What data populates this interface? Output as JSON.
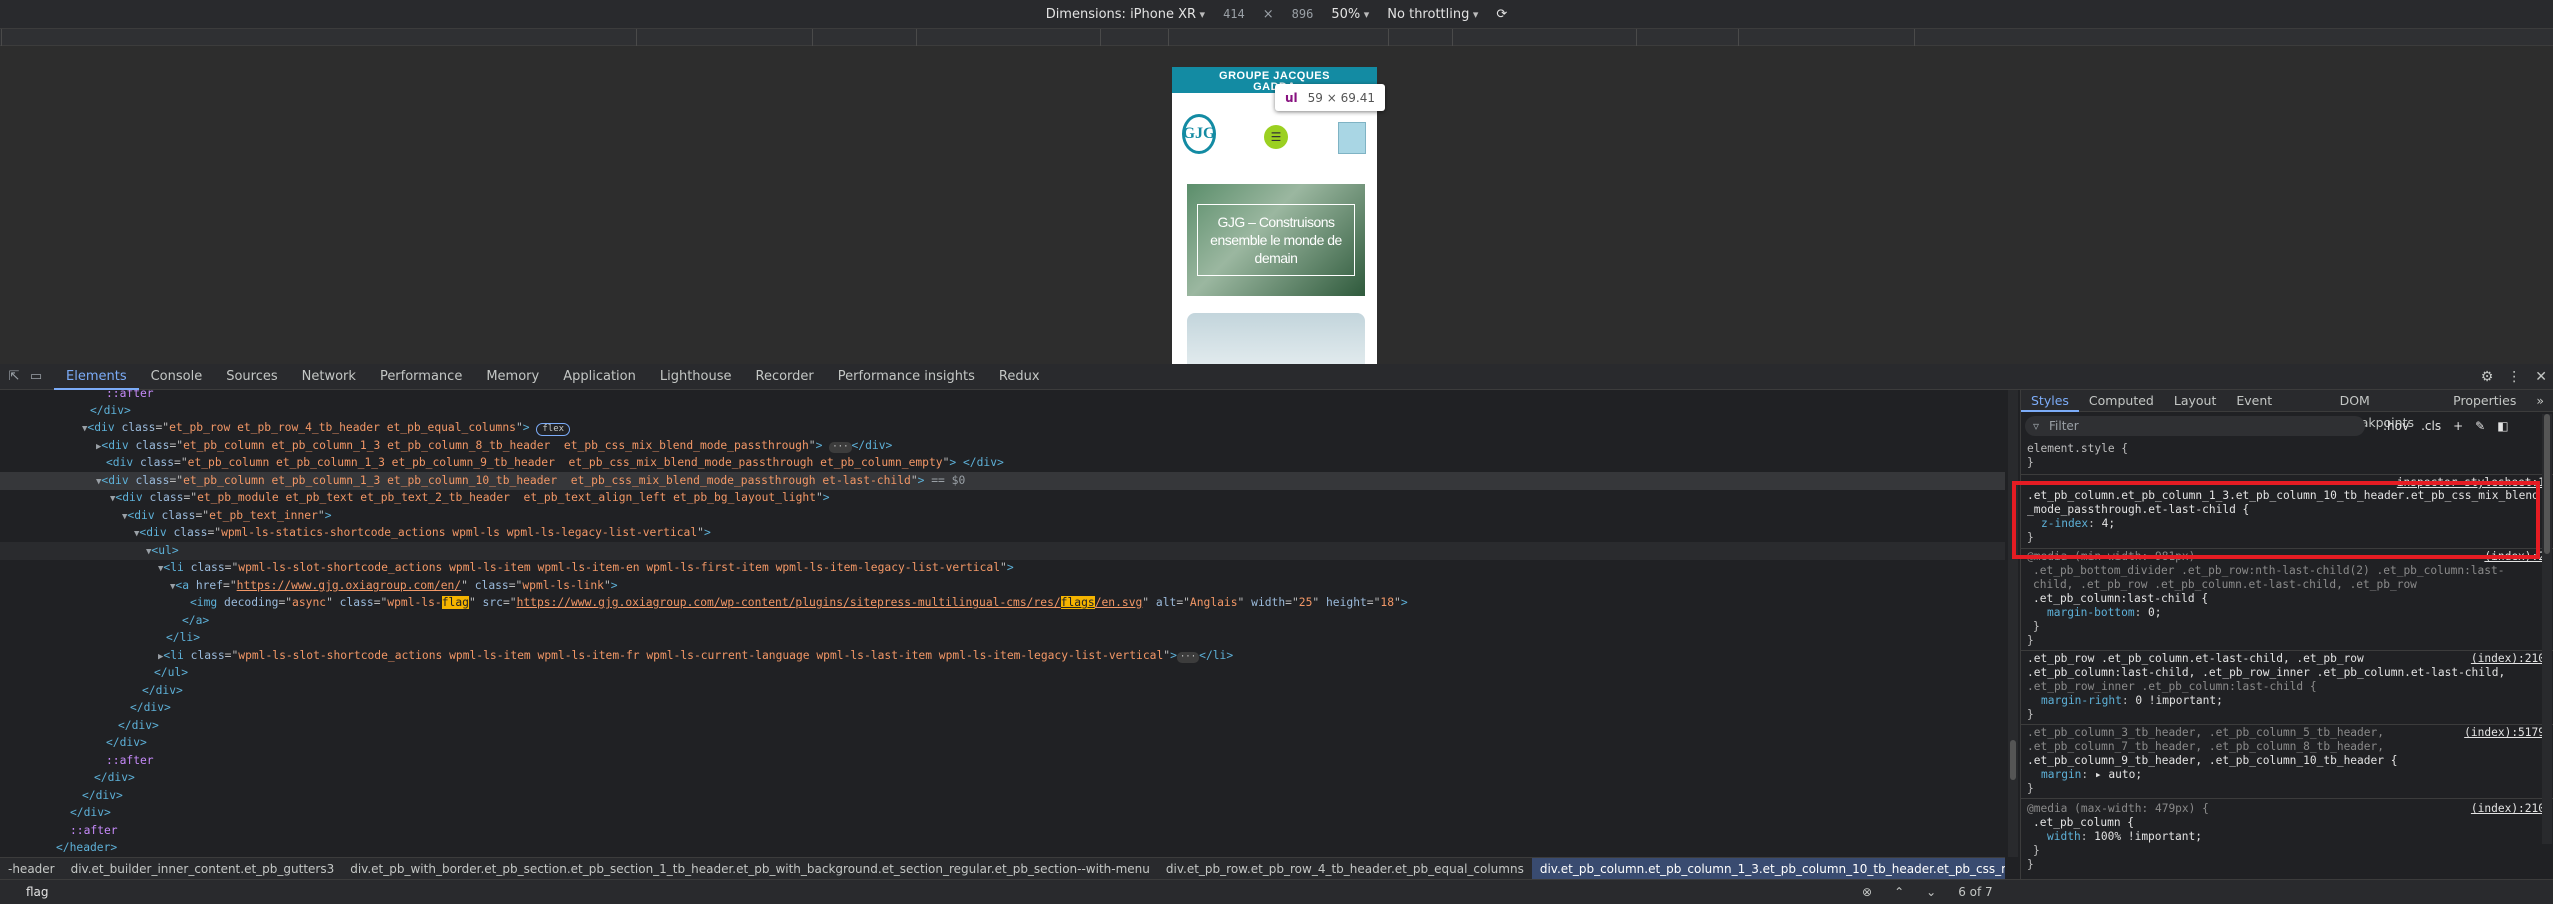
{
  "device_toolbar": {
    "dimensions": "Dimensions: iPhone XR",
    "width": "414",
    "times": "×",
    "height": "896",
    "zoom": "50%",
    "throttling": "No throttling"
  },
  "phone": {
    "brand_line1": "GROUPE JACQUES",
    "brand_line2": "GADDA",
    "logo": "GJG",
    "hero_text": "GJG – Construisons ensemble le monde de demain"
  },
  "tooltip": {
    "tag": "ul",
    "size": "59 × 69.41"
  },
  "tabs": [
    "Elements",
    "Console",
    "Sources",
    "Network",
    "Performance",
    "Memory",
    "Application",
    "Lighthouse",
    "Recorder",
    "Performance insights",
    "Redux"
  ],
  "dom": {
    "l0": "::after",
    "l1": "</div>",
    "l2_open": "<div class=\"",
    "l2_class": "et_pb_row et_pb_row_4_tb_header et_pb_equal_columns",
    "l2_close": "\">",
    "l2_badge": "flex",
    "l3_class": "et_pb_column et_pb_column_1_3 et_pb_column_8_tb_header  et_pb_css_mix_blend_mode_passthrough",
    "l4_class": "et_pb_column et_pb_column_1_3 et_pb_column_9_tb_header  et_pb_css_mix_blend_mode_passthrough et_pb_column_empty",
    "l5_class": "et_pb_column et_pb_column_1_3 et_pb_column_10_tb_header  et_pb_css_mix_blend_mode_passthrough et-last-child",
    "l5_eq": "== $0",
    "l6_class": "et_pb_module et_pb_text et_pb_text_2_tb_header  et_pb_text_align_left et_pb_bg_layout_light",
    "l7_class": "et_pb_text_inner",
    "l8_class": "wpml-ls-statics-shortcode_actions wpml-ls wpml-ls-legacy-list-vertical",
    "l9": "<ul>",
    "l10_class": "wpml-ls-slot-shortcode_actions wpml-ls-item wpml-ls-item-en wpml-ls-first-item wpml-ls-item-legacy-list-vertical",
    "l11_href": "https://www.gjg.oxiagroup.com/en/",
    "l11_class": "wpml-ls-link",
    "l12_decoding": "async",
    "l12_class_pre": "wpml-ls-",
    "l12_class_hl": "flag",
    "l12_src_pre": "https://www.gjg.oxiagroup.com/wp-content/plugins/sitepress-multilingual-cms/res/",
    "l12_src_hl": "flags",
    "l12_src_post": "/en.svg",
    "l12_alt": "Anglais",
    "l12_width": "25",
    "l12_height": "18",
    "l13": "</a>",
    "l14": "</li>",
    "l15_class": "wpml-ls-slot-shortcode_actions wpml-ls-item wpml-ls-item-fr wpml-ls-current-language wpml-ls-last-item wpml-ls-item-legacy-list-vertical",
    "l16": "</ul>",
    "l17": "</div>",
    "l18": "</div>",
    "l19": "</div>",
    "l20": "</div>",
    "l21": "::after",
    "l22": "</div>",
    "l23": "</div>",
    "l24": "</div>",
    "l25": "::after",
    "l26": "</header>"
  },
  "breadcrumbs": [
    "-header",
    "div.et_builder_inner_content.et_pb_gutters3",
    "div.et_pb_with_border.et_pb_section.et_pb_section_1_tb_header.et_pb_with_background.et_section_regular.et_pb_section--with-menu",
    "div.et_pb_row.et_pb_row_4_tb_header.et_pb_equal_columns",
    "div.et_pb_column.et_pb_column_1_3.et_pb_column_10_tb_header.et_pb_css_mix_blend_mode_passthrough.et-last-child"
  ],
  "search": {
    "query": "flag",
    "count": "6 of 7",
    "cancel": "Cancel"
  },
  "styles_tabs": [
    "Styles",
    "Computed",
    "Layout",
    "Event Listeners",
    "DOM Breakpoints",
    "Properties"
  ],
  "styles": {
    "filter_placeholder": "Filter",
    "hov": ":hov",
    "cls": ".cls",
    "element_style": "element.style {",
    "close": "}",
    "r1_src": "inspector-stylesheet:1",
    "r1_sel1": ".et_pb_column.et_pb_column_1_3.et_pb_column_10_tb_header.et_pb_css_mix_blend",
    "r1_sel2": "_mode_passthrough.et-last-child {",
    "r1_prop": "z-index",
    "r1_val": "4;",
    "r2_src": "(index):2",
    "r2_head": "@media (min-width: 981px)",
    "r2_sel1": ".et_pb_bottom_divider .et_pb_row:nth-last-child(2) .et_pb_column:last-",
    "r2_sel2": "child, .et_pb_row .et_pb_column.et-last-child, .et_pb_row",
    "r2_sel3": ".et_pb_column:last-child {",
    "r2_prop": "margin-bottom",
    "r2_val": "0;",
    "r3_src": "(index):210",
    "r3_sel1": ".et_pb_row .et_pb_column.et-last-child, .et_pb_row",
    "r3_sel2": ".et_pb_column:last-child, .et_pb_row_inner .et_pb_column.et-last-child,",
    "r3_sel3": ".et_pb_row_inner .et_pb_column:last-child {",
    "r3_prop": "margin-right",
    "r3_val": "0 !important;",
    "r4_src": "(index):5179",
    "r4_sel1": ".et_pb_column_3_tb_header, .et_pb_column_5_tb_header,",
    "r4_sel2": ".et_pb_column_7_tb_header, .et_pb_column_8_tb_header,",
    "r4_sel3": ".et_pb_column_9_tb_header, .et_pb_column_10_tb_header {",
    "r4_prop": "margin",
    "r4_val": "▸ auto;",
    "r5_src": "(index):210",
    "r5_head": "@media (max-width: 479px) {",
    "r5_sel1": ".et_pb_column {",
    "r5_prop": "width",
    "r5_val": "100% !important;"
  },
  "colors": {
    "accent": "#7cacf8",
    "highlight_box": "#e51c23",
    "search_highlight": "#f5b400"
  }
}
